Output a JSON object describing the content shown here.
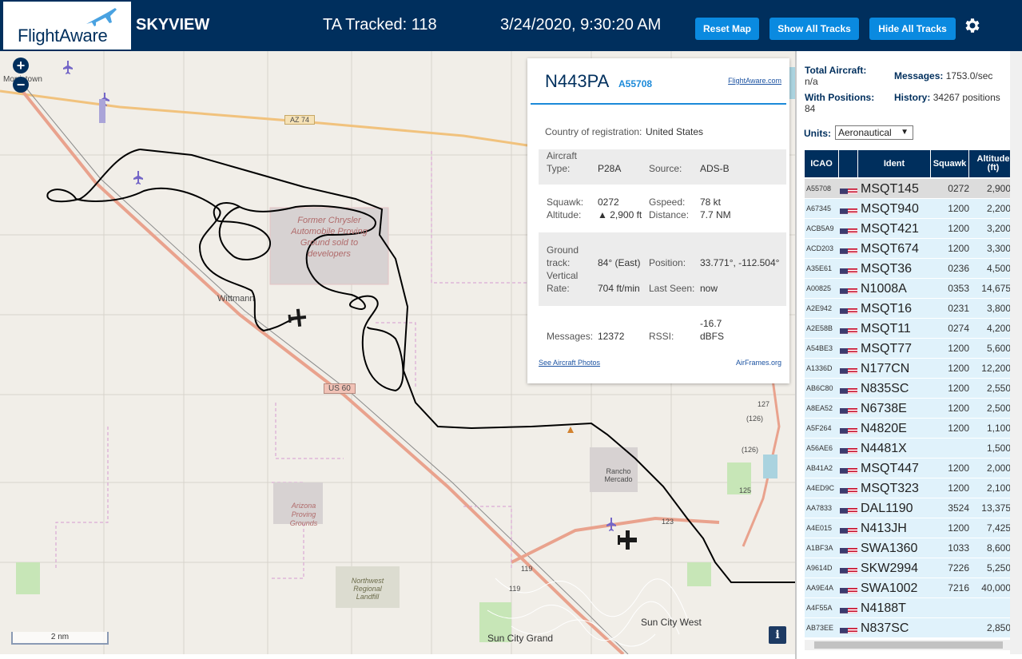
{
  "header": {
    "logo_text": "FlightAware",
    "site_name": "SKYVIEW",
    "tracked_label": "TA Tracked: 118",
    "datetime": "3/24/2020, 9:30:20 AM",
    "reset_map": "Reset Map",
    "show_all_tracks": "Show All Tracks",
    "hide_all_tracks": "Hide All Tracks",
    "settings_icon": "gear-icon"
  },
  "colors": {
    "header_bg": "#002f5d",
    "button_bg": "#0a8ae0",
    "accent": "#1c8ad9",
    "row_bg": "#e0f2fb",
    "selected_row_bg": "#dcdcdc",
    "track": "#000000"
  },
  "map": {
    "zoom_in": "+",
    "zoom_out": "−",
    "scale": "2 nm",
    "info": "i",
    "labels": {
      "morristown": "Morristown",
      "az74": "AZ 74",
      "wittmann": "Wittmann",
      "us60": "US 60",
      "rancho": "Rancho Mercado",
      "sun_city_west": "Sun City West",
      "sun_city_grand": "Sun City Grand",
      "former_chrysler": "Former Chrysler Automobile Proving Ground sold to developers",
      "arizona_proving": "Arizona Proving Grounds",
      "northwest_landfill": "Northwest Regional Landfill",
      "r127": "127",
      "r126a": "(126)",
      "r126b": "(126)",
      "r125": "125",
      "r123": "123",
      "r119": "119",
      "r119b": "119"
    }
  },
  "popup": {
    "ident": "N443PA",
    "hex": "A55708",
    "fa_link": "FlightAware.com",
    "country_label": "Country of registration:",
    "country": "United States",
    "aircraft_type_label": "Aircraft Type:",
    "aircraft_type": "P28A",
    "source_label": "Source:",
    "source": "ADS-B",
    "squawk_label": "Squawk:",
    "squawk": "0272",
    "gspeed_label": "Gspeed:",
    "gspeed": "78 kt",
    "altitude_label": "Altitude:",
    "altitude": "▲ 2,900 ft",
    "distance_label": "Distance:",
    "distance": "7.7 NM",
    "track_label": "Ground track:",
    "track": "84° (East)",
    "position_label": "Position:",
    "position": "33.771°, -112.504°",
    "vrate_label": "Vertical Rate:",
    "vrate": "704 ft/min",
    "last_seen_label": "Last Seen:",
    "last_seen": "now",
    "messages_label": "Messages:",
    "messages": "12372",
    "rssi_label": "RSSI:",
    "rssi": "-16.7 dBFS",
    "photos_link": "See Aircraft Photos",
    "airframes_link": "AirFrames.org"
  },
  "sidebar": {
    "total_label": "Total Aircraft:",
    "total_value": "n/a",
    "messages_label": "Messages:",
    "messages_value": "1753.0/sec",
    "with_pos_label": "With Positions:",
    "with_pos_value": "84",
    "history_label": "History:",
    "history_value": "34267 positions",
    "units_label": "Units:",
    "units_value": "Aeronautical",
    "columns": [
      "ICAO",
      "",
      "Ident",
      "Squawk",
      "Altitude (ft)"
    ],
    "rows": [
      {
        "icao": "A55708",
        "ident": "MSQT145",
        "squawk": "0272",
        "alt": "2,900",
        "trend": "▲",
        "selected": true
      },
      {
        "icao": "A67345",
        "ident": "MSQT940",
        "squawk": "1200",
        "alt": "2,200",
        "trend": ""
      },
      {
        "icao": "ACB5A9",
        "ident": "MSQT421",
        "squawk": "1200",
        "alt": "3,200",
        "trend": "▼"
      },
      {
        "icao": "ACD203",
        "ident": "MSQT674",
        "squawk": "1200",
        "alt": "3,300",
        "trend": "▲"
      },
      {
        "icao": "A35E61",
        "ident": "MSQT36",
        "squawk": "0236",
        "alt": "4,500",
        "trend": "▼"
      },
      {
        "icao": "A00825",
        "ident": "N1008A",
        "squawk": "0353",
        "alt": "14,675",
        "trend": ""
      },
      {
        "icao": "A2E942",
        "ident": "MSQT16",
        "squawk": "0231",
        "alt": "3,800",
        "trend": ""
      },
      {
        "icao": "A2E58B",
        "ident": "MSQT11",
        "squawk": "0274",
        "alt": "4,200",
        "trend": "▼"
      },
      {
        "icao": "A54BE3",
        "ident": "MSQT77",
        "squawk": "1200",
        "alt": "5,600",
        "trend": "▲"
      },
      {
        "icao": "A1336D",
        "ident": "N177CN",
        "squawk": "1200",
        "alt": "12,200",
        "trend": ""
      },
      {
        "icao": "AB6C80",
        "ident": "N835SC",
        "squawk": "1200",
        "alt": "2,550",
        "trend": ""
      },
      {
        "icao": "A8EA52",
        "ident": "N6738E",
        "squawk": "1200",
        "alt": "2,500",
        "trend": "▲"
      },
      {
        "icao": "A5F264",
        "ident": "N4820E",
        "squawk": "1200",
        "alt": "1,100",
        "trend": "▼"
      },
      {
        "icao": "A56AE6",
        "ident": "N4481X",
        "squawk": "",
        "alt": "1,500",
        "trend": ""
      },
      {
        "icao": "AB41A2",
        "ident": "MSQT447",
        "squawk": "1200",
        "alt": "2,000",
        "trend": ""
      },
      {
        "icao": "A4ED9C",
        "ident": "MSQT323",
        "squawk": "1200",
        "alt": "2,100",
        "trend": ""
      },
      {
        "icao": "AA7833",
        "ident": "DAL1190",
        "squawk": "3524",
        "alt": "13,375",
        "trend": "▼"
      },
      {
        "icao": "A4E015",
        "ident": "N413JH",
        "squawk": "1200",
        "alt": "7,425",
        "trend": "▲"
      },
      {
        "icao": "A1BF3A",
        "ident": "SWA1360",
        "squawk": "1033",
        "alt": "8,600",
        "trend": "▼"
      },
      {
        "icao": "A9614D",
        "ident": "SKW2994",
        "squawk": "7226",
        "alt": "5,250",
        "trend": "▼"
      },
      {
        "icao": "AA9E4A",
        "ident": "SWA1002",
        "squawk": "7216",
        "alt": "40,000",
        "trend": ""
      },
      {
        "icao": "A4F55A",
        "ident": "N4188T",
        "squawk": "",
        "alt": "",
        "trend": ""
      },
      {
        "icao": "AB73EE",
        "ident": "N837SC",
        "squawk": "",
        "alt": "2,850",
        "trend": "▼"
      }
    ]
  }
}
